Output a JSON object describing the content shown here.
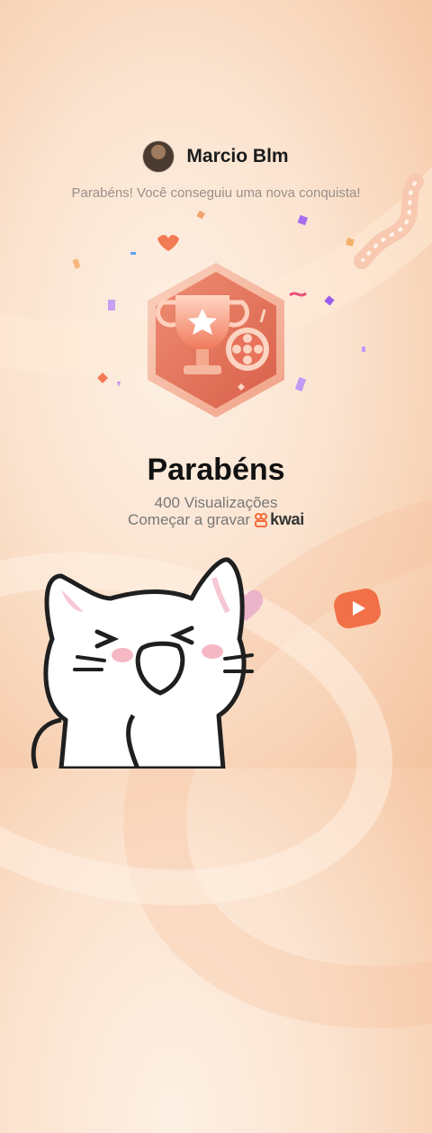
{
  "profile": {
    "username": "Marcio Blm",
    "message": "Parabéns! Você conseguiu uma nova conquista!"
  },
  "achievement": {
    "title": "Parabéns",
    "views": "400 Visualizações",
    "record_text": "Começar a gravar",
    "brand": "kwai"
  },
  "colors": {
    "accent": "#f26b3a",
    "badge_light": "#f7b8a0",
    "badge_dark": "#e2705a"
  }
}
